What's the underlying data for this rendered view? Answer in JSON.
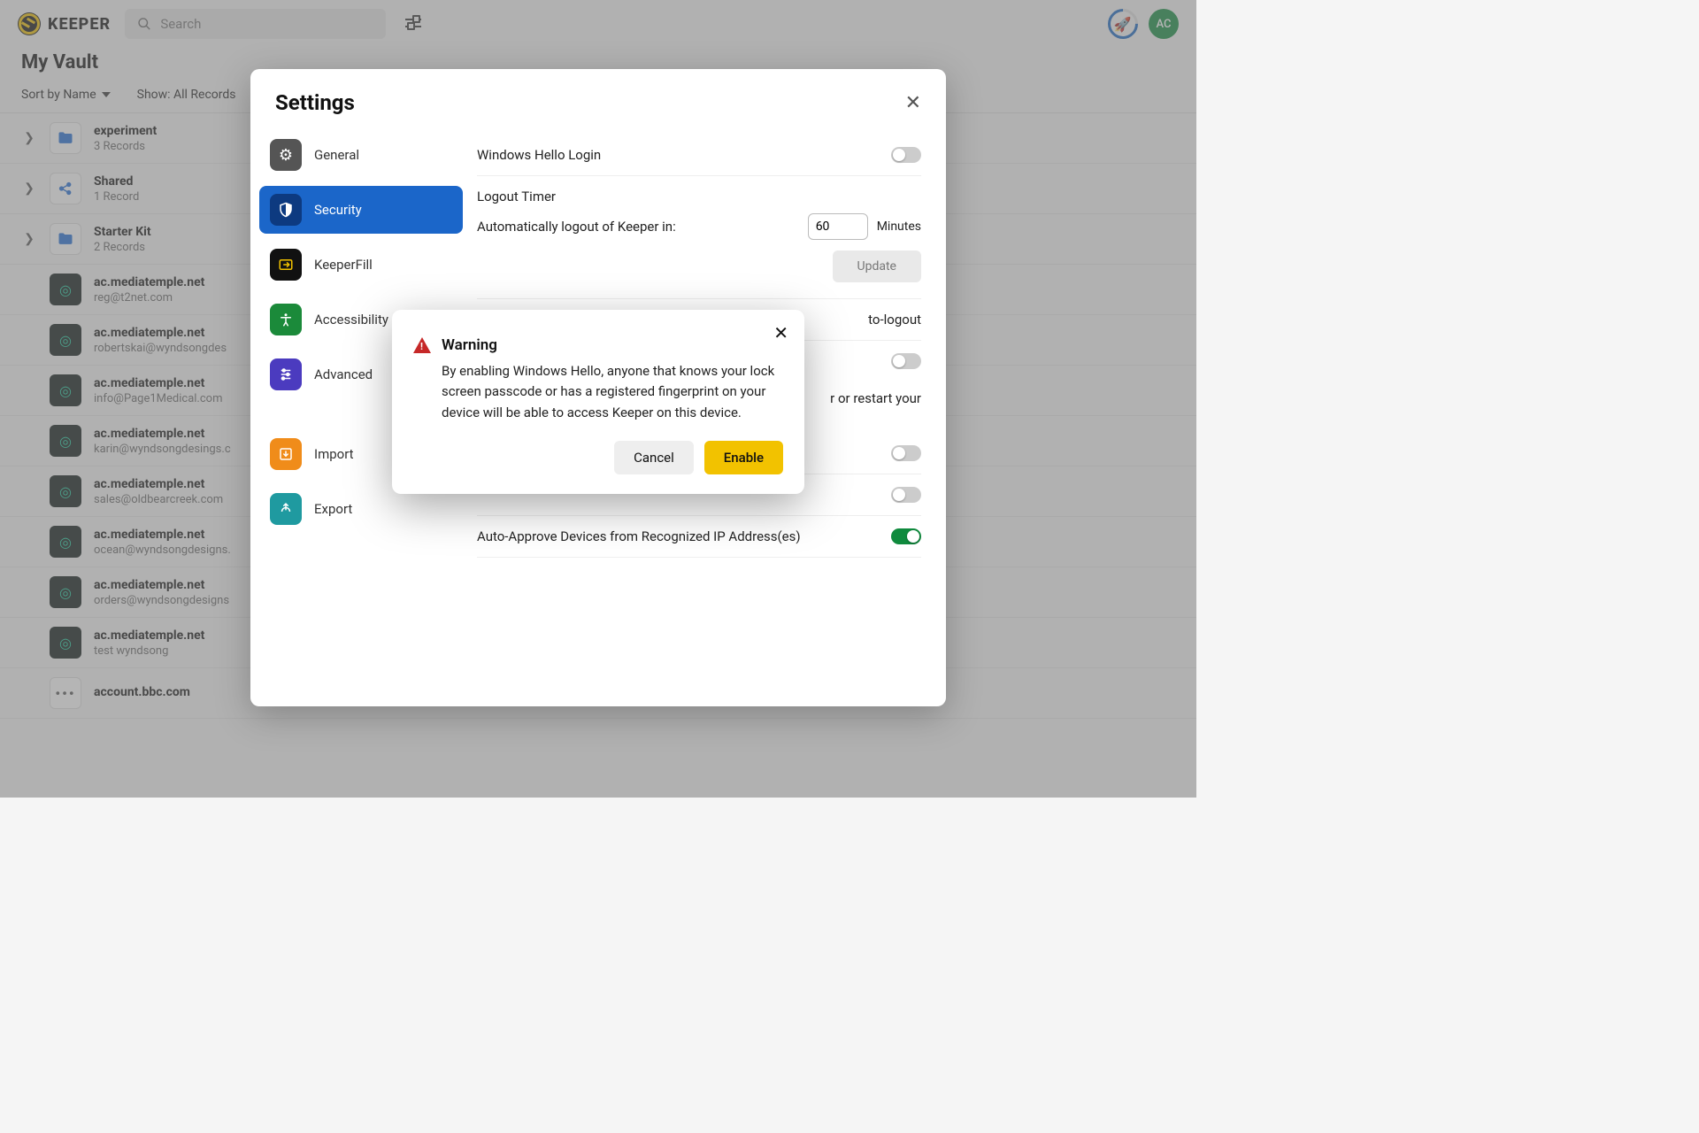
{
  "header": {
    "brand": "KEEPER",
    "search_placeholder": "Search",
    "avatar_initials": "AC"
  },
  "vault": {
    "title": "My Vault",
    "sort_label": "Sort by Name",
    "show_label": "Show: All Records",
    "folders": [
      {
        "name": "experiment",
        "sub": "3 Records",
        "icon": "folder"
      },
      {
        "name": "Shared",
        "sub": "1 Record",
        "icon": "share"
      },
      {
        "name": "Starter Kit",
        "sub": "2 Records",
        "icon": "folder"
      }
    ],
    "records": [
      {
        "name": "ac.mediatemple.net",
        "sub": "reg@t2net.com"
      },
      {
        "name": "ac.mediatemple.net",
        "sub": "robertskai@wyndsongdes"
      },
      {
        "name": "ac.mediatemple.net",
        "sub": "info@Page1Medical.com"
      },
      {
        "name": "ac.mediatemple.net",
        "sub": "karin@wyndsongdesings.c"
      },
      {
        "name": "ac.mediatemple.net",
        "sub": "sales@oldbearcreek.com"
      },
      {
        "name": "ac.mediatemple.net",
        "sub": "ocean@wyndsongdesigns."
      },
      {
        "name": "ac.mediatemple.net",
        "sub": "orders@wyndsongdesigns"
      },
      {
        "name": "ac.mediatemple.net",
        "sub": "test wyndsong"
      },
      {
        "name": "account.bbc.com",
        "sub": ""
      }
    ]
  },
  "settings": {
    "title": "Settings",
    "nav": {
      "general": "General",
      "security": "Security",
      "keeperfill": "KeeperFill",
      "accessibility": "Accessibility",
      "advanced": "Advanced",
      "import": "Import",
      "export": "Export"
    },
    "security": {
      "windows_hello": "Windows Hello Login",
      "logout_timer": "Logout Timer",
      "auto_logout_text": "Automatically logout of Keeper in:",
      "timeout_value": "60",
      "minutes": "Minutes",
      "update": "Update",
      "partial1": "to-logout",
      "partial2": "r or restart your",
      "auto_approve": "Auto-Approve Devices from Recognized IP Address(es)"
    }
  },
  "warning": {
    "title": "Warning",
    "body": "By enabling Windows Hello, anyone that knows your lock screen passcode or has a registered fingerprint on your device will be able to access Keeper on this device.",
    "cancel": "Cancel",
    "enable": "Enable"
  }
}
